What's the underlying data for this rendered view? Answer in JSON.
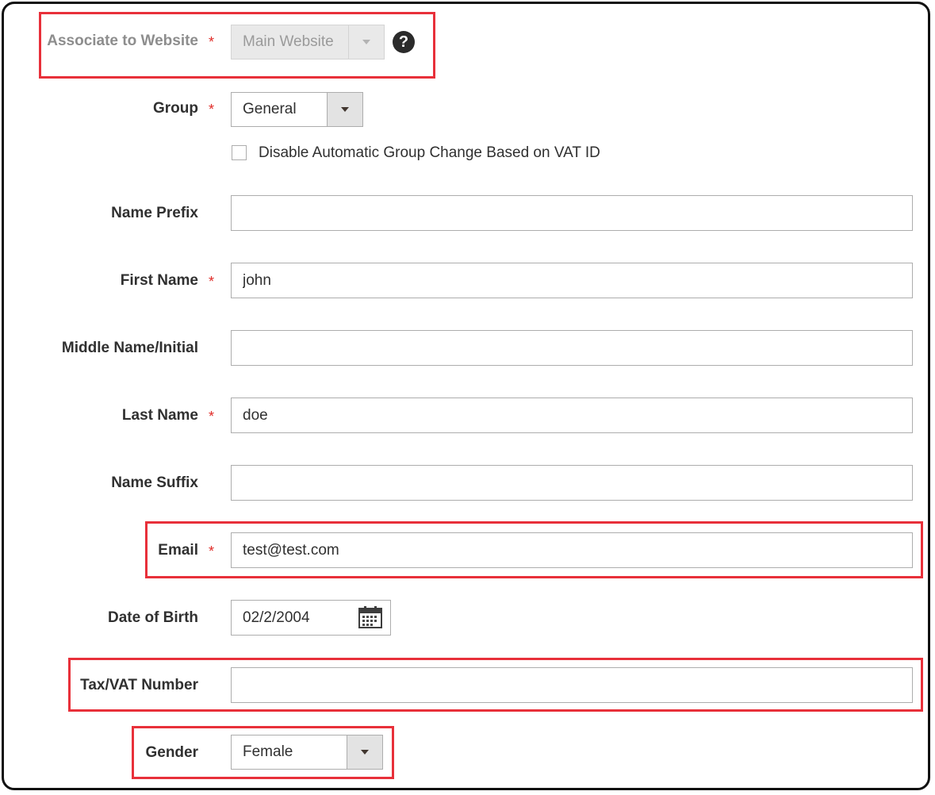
{
  "colors": {
    "highlight": "#e8303a",
    "required": "#e02b27"
  },
  "form": {
    "website": {
      "label": "Associate to Website",
      "required": "*",
      "value": "Main Website",
      "help_icon": "question-circle-icon",
      "help_text": "?"
    },
    "group": {
      "label": "Group",
      "required": "*",
      "value": "General"
    },
    "disable_group_change": {
      "label": "Disable Automatic Group Change Based on VAT ID",
      "checked": false
    },
    "prefix": {
      "label": "Name Prefix",
      "value": ""
    },
    "first_name": {
      "label": "First Name",
      "required": "*",
      "value": "john"
    },
    "middle_name": {
      "label": "Middle Name/Initial",
      "value": ""
    },
    "last_name": {
      "label": "Last Name",
      "required": "*",
      "value": "doe"
    },
    "suffix": {
      "label": "Name Suffix",
      "value": ""
    },
    "email": {
      "label": "Email",
      "required": "*",
      "value": "test@test.com"
    },
    "dob": {
      "label": "Date of Birth",
      "value": "02/2/2004",
      "icon": "calendar-icon"
    },
    "taxvat": {
      "label": "Tax/VAT Number",
      "value": ""
    },
    "gender": {
      "label": "Gender",
      "value": "Female"
    }
  }
}
